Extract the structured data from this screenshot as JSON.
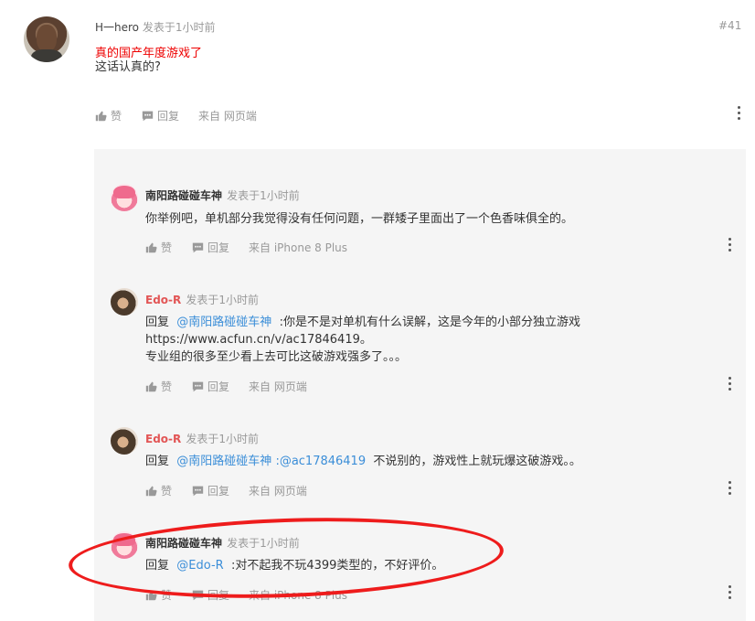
{
  "post": {
    "username": "H一hero",
    "time": "发表于1小时前",
    "floor": "#41",
    "line1": "真的国产年度游戏了",
    "line2": "这话认真的?",
    "like_label": "赞",
    "reply_label": "回复",
    "source": "来自 网页端"
  },
  "replies": [
    {
      "username": "南阳路碰碰车神",
      "time": "发表于1小时前",
      "text": "你举例吧，单机部分我觉得没有任何问题，一群矮子里面出了一个色香味俱全的。",
      "like_label": "赞",
      "reply_label": "回复",
      "source": "来自 iPhone  8  Plus"
    },
    {
      "username": "Edo-R",
      "time": "发表于1小时前",
      "prefix": "回复",
      "mention": "@南阳路碰碰车神",
      "text": ":你是不是对单机有什么误解，这是今年的小部分独立游戏",
      "text2": "https://www.acfun.cn/v/ac17846419。",
      "text3": "专业组的很多至少看上去可比这破游戏强多了。。。",
      "like_label": "赞",
      "reply_label": "回复",
      "source": "来自 网页端"
    },
    {
      "username": "Edo-R",
      "time": "发表于1小时前",
      "prefix": "回复",
      "mention": "@南阳路碰碰车神",
      "mention2": ":@ac17846419",
      "text": "不说别的，游戏性上就玩爆这破游戏。。",
      "like_label": "赞",
      "reply_label": "回复",
      "source": "来自 网页端"
    },
    {
      "username": "南阳路碰碰车神",
      "time": "发表于1小时前",
      "prefix": "回复",
      "mention": "@Edo-R",
      "text": ":对不起我不玩4399类型的，不好评价。",
      "like_label": "赞",
      "reply_label": "回复",
      "source": "来自 iPhone  8  Plus"
    }
  ],
  "colors": {
    "highlight_text": "#ee0000",
    "mention": "#3b8ed8",
    "annotation_circle": "#ee1c1c",
    "reply_bg": "#f5f5f5"
  },
  "icons": [
    "thumbs-up-icon",
    "reply-icon",
    "more-vertical-icon"
  ]
}
